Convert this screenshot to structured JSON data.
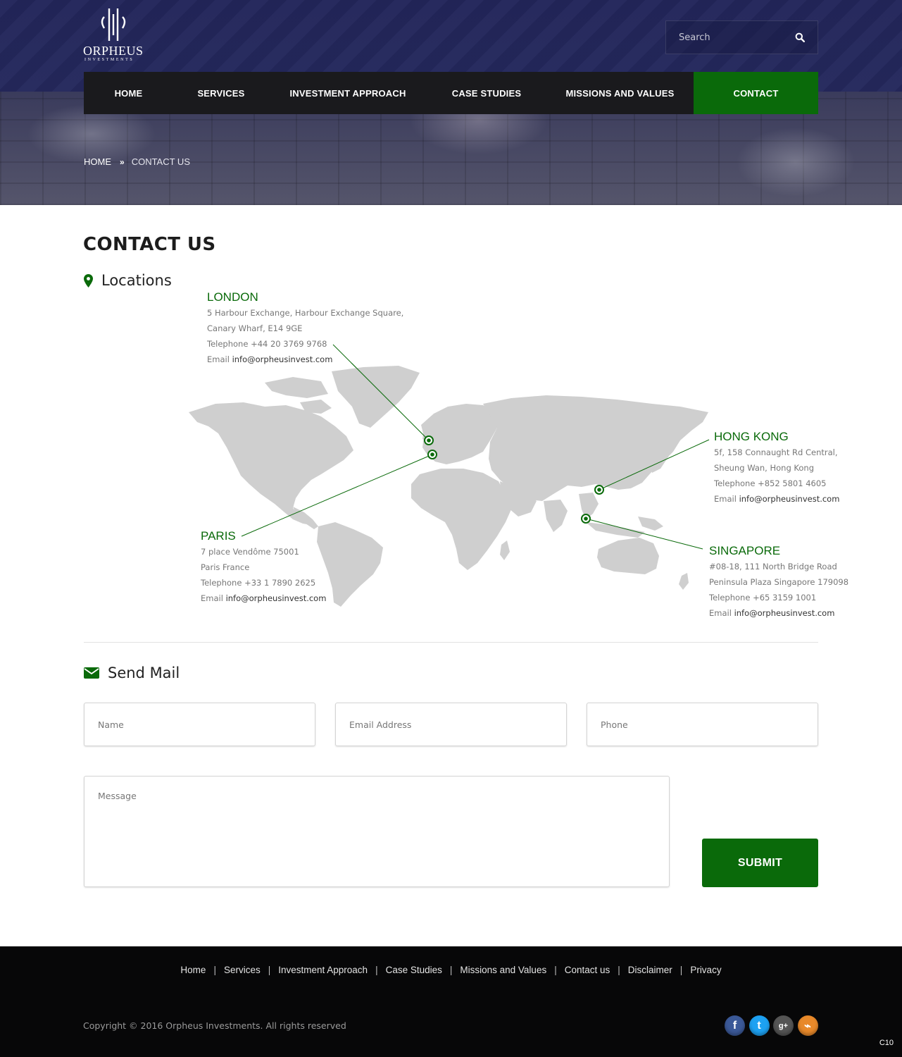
{
  "brand": {
    "name": "ORPHEUS",
    "tagline": "INVESTMENTS"
  },
  "search": {
    "placeholder": "Search"
  },
  "nav": {
    "items": [
      {
        "label": "HOME"
      },
      {
        "label": "SERVICES"
      },
      {
        "label": "INVESTMENT APPROACH"
      },
      {
        "label": "CASE STUDIES"
      },
      {
        "label": "MISSIONS AND VALUES"
      },
      {
        "label": "CONTACT",
        "active": true
      }
    ]
  },
  "breadcrumb": {
    "home": "HOME",
    "current": "CONTACT US"
  },
  "page": {
    "title": "CONTACT US"
  },
  "locations": {
    "heading": "Locations",
    "offices": [
      {
        "city": "LONDON",
        "line1": "5 Harbour Exchange, Harbour Exchange Square,",
        "line2": "Canary Wharf, E14 9GE",
        "phone_label": "Telephone",
        "phone": "+44 20 3769 9768",
        "email_label": "Email",
        "email": "info@orpheusinvest.com"
      },
      {
        "city": "HONG KONG",
        "line1": "5f, 158 Connaught Rd Central,",
        "line2": "Sheung Wan, Hong Kong",
        "phone_label": "Telephone",
        "phone": "+852 5801 4605",
        "email_label": "Email",
        "email": "info@orpheusinvest.com"
      },
      {
        "city": "PARIS",
        "line1": "7 place Vendôme 75001",
        "line2": "Paris France",
        "phone_label": "Telephone",
        "phone": "+33 1 7890 2625",
        "email_label": "Email",
        "email": "info@orpheusinvest.com"
      },
      {
        "city": "SINGAPORE",
        "line1": "#08-18, 111 North Bridge Road",
        "line2": "Peninsula Plaza Singapore 179098",
        "phone_label": "Telephone",
        "phone": "+65 3159 1001",
        "email_label": "Email",
        "email": "info@orpheusinvest.com"
      }
    ]
  },
  "mail_form": {
    "heading": "Send Mail",
    "name_placeholder": "Name",
    "email_placeholder": "Email Address",
    "phone_placeholder": "Phone",
    "message_placeholder": "Message",
    "submit_label": "SUBMIT"
  },
  "footer": {
    "links": [
      {
        "label": "Home"
      },
      {
        "label": "Services"
      },
      {
        "label": "Investment Approach"
      },
      {
        "label": "Case Studies"
      },
      {
        "label": "Missions and Values"
      },
      {
        "label": "Contact us"
      },
      {
        "label": "Disclaimer"
      },
      {
        "label": "Privacy"
      }
    ],
    "copyright": "Copyright © 2016 Orpheus Investments. All rights reserved",
    "social": [
      {
        "icon": "facebook-icon",
        "glyph": "f",
        "color": "#3b5998"
      },
      {
        "icon": "twitter-icon",
        "glyph": "t",
        "color": "#1da1f2"
      },
      {
        "icon": "google-plus-icon",
        "glyph": "g+",
        "color": "#555555"
      },
      {
        "icon": "rss-icon",
        "glyph": "⌁",
        "color": "#e8892a"
      }
    ],
    "corner_code": "C10"
  },
  "colors": {
    "accent": "#0a6a0a",
    "nav_bg": "#1a1a1d",
    "footer_bg": "#070708",
    "map_land": "#cfcfcf"
  }
}
